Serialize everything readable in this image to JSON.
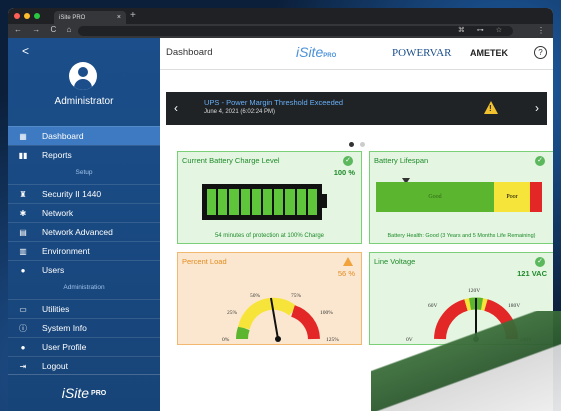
{
  "browser": {
    "tab_title": "iSite PRO",
    "tab_close": "×",
    "new_tab": "+",
    "nav": "← → C ⌂",
    "omni_right": "⌘ ⊶ ☆",
    "menu": "⋮"
  },
  "sidebar": {
    "back": "<",
    "user": "Administrator",
    "items": [
      {
        "label": "Dashboard",
        "icon": "▦"
      },
      {
        "label": "Reports",
        "icon": "▮▮"
      }
    ],
    "setup_label": "Setup",
    "setup_items": [
      {
        "label": "Security II 1440",
        "icon": "♜"
      },
      {
        "label": "Network",
        "icon": "✱"
      },
      {
        "label": "Network Advanced",
        "icon": "▤"
      },
      {
        "label": "Environment",
        "icon": "▥"
      },
      {
        "label": "Users",
        "icon": "●"
      }
    ],
    "admin_label": "Administration",
    "admin_items": [
      {
        "label": "Utilities",
        "icon": "▭"
      },
      {
        "label": "System Info",
        "icon": "ⓘ"
      },
      {
        "label": "User Profile",
        "icon": "●"
      },
      {
        "label": "Logout",
        "icon": "⇥"
      }
    ],
    "footer_logo": "iSite",
    "footer_logo_pro": "PRO"
  },
  "header": {
    "title": "Dashboard",
    "logo": "iSite",
    "logo_pro": "PRO",
    "powervar": "POWERVAR",
    "ametek": "AMETEK",
    "help": "?"
  },
  "alert": {
    "title": "UPS - Power Margin Threshold Exceeded",
    "time": "June 4, 2021 (6:02:24 PM)",
    "prev": "‹",
    "next": "›",
    "warn": "!"
  },
  "cards": {
    "battery": {
      "title": "Current Battery Charge Level",
      "value": "100 %",
      "footer": "54 minutes of protection at 100% Charge",
      "level": 1.0
    },
    "lifespan": {
      "title": "Battery Lifespan",
      "good": "Good",
      "poor": "Poor",
      "footer": "Battery Health: Good (3 Years and 5 Months Life Remaining)"
    },
    "load": {
      "title": "Percent Load",
      "value": "56 %",
      "ticks": [
        "0%",
        "25%",
        "50%",
        "75%",
        "100%",
        "125%"
      ],
      "level": 56
    },
    "voltage": {
      "title": "Line Voltage",
      "value": "121 VAC",
      "ticks": [
        "0V",
        "60V",
        "120V",
        "180V",
        "240V"
      ],
      "level": 121
    }
  },
  "colors": {
    "sidebar": "#1b4e8a",
    "active": "#3e7ac2",
    "green": "#5cb52f",
    "yellow": "#f7e43a",
    "red": "#e32626"
  }
}
